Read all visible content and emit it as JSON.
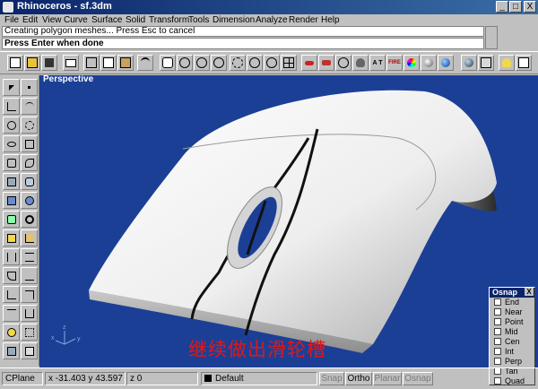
{
  "window": {
    "title": "Rhinoceros - sf.3dm",
    "minimize": "_",
    "maximize": "□",
    "close": "X"
  },
  "menu": [
    "File",
    "Edit",
    "View",
    "Curve",
    "Surface",
    "Solid",
    "Transform",
    "Tools",
    "Dimension",
    "Analyze",
    "Render",
    "Help"
  ],
  "command": {
    "history": "Creating polygon meshes... Press Esc to cancel",
    "prompt": "Press Enter when done"
  },
  "toolbar": {
    "items": [
      "new-icon",
      "open-icon",
      "save-icon",
      "print-icon",
      "cut-icon",
      "copy-icon",
      "paste-icon",
      "undo-icon",
      "pan-icon",
      "rotate-view-icon",
      "zoom-window-icon",
      "zoom-dynamic-icon",
      "zoom-extents-icon",
      "zoom-selected-icon",
      "undo-view-icon",
      "four-viewports-icon",
      "car-icon",
      "render-icon",
      "cloud-icon",
      "teapot-icon",
      "a-text-icon",
      "fire-text-icon",
      "color-wheel-icon",
      "grey-sphere-icon",
      "blue-sphere-icon",
      "globe-icon",
      "properties-icon",
      "lamp-icon",
      "settings-icon"
    ],
    "text_labels": {
      "a-text-icon": "A T",
      "fire-text-icon": "FIRE"
    }
  },
  "viewport": {
    "label": "Perspective",
    "caption": "继续做出滑轮槽",
    "axis_labels": {
      "z": "z",
      "x": "x",
      "y": "y"
    }
  },
  "osnap": {
    "title": "Osnap",
    "close": "X",
    "items": [
      "End",
      "Near",
      "Point",
      "Mid",
      "Cen",
      "Int",
      "Perp",
      "Tan",
      "Quad"
    ]
  },
  "status": {
    "plane": "CPlane",
    "coords": "x -31.403  y 43.597",
    "z": "z 0",
    "layer": "Default",
    "snap": "Snap",
    "ortho": "Ortho",
    "planar": "Planar",
    "osnap": "Osnap"
  },
  "colors": {
    "viewport": "#1c3f96",
    "caption": "#e01818",
    "titlebar": "#0a246a"
  }
}
